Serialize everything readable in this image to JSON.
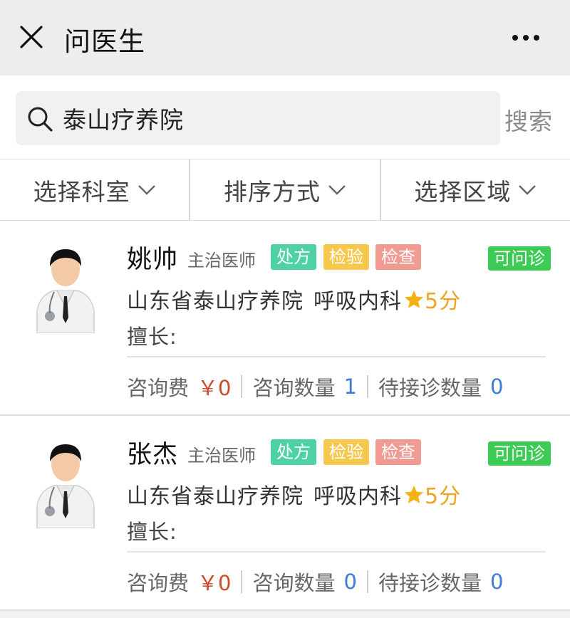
{
  "topbar": {
    "title": "问医生",
    "close_icon": "close-icon",
    "more_icon": "more-icon"
  },
  "search": {
    "value": "泰山疗养院",
    "button_label": "搜索",
    "icon": "search-icon"
  },
  "filters": [
    {
      "label": "选择科室",
      "icon": "chevron-down-icon"
    },
    {
      "label": "排序方式",
      "icon": "chevron-down-icon"
    },
    {
      "label": "选择区域",
      "icon": "chevron-down-icon"
    }
  ],
  "doctors": [
    {
      "name": "姚帅",
      "rank": "主治医师",
      "tags": [
        "处方",
        "检验",
        "检查"
      ],
      "status": "可问诊",
      "hospital": "山东省泰山疗养院",
      "department": "呼吸内科",
      "score": "5分",
      "specialty": "擅长:",
      "fee_label": "咨询费",
      "fee": "￥0",
      "consult_label": "咨询数量",
      "consult_count": "1",
      "pending_label": "待接诊数量",
      "pending_count": "0"
    },
    {
      "name": "张杰",
      "rank": "主治医师",
      "tags": [
        "处方",
        "检验",
        "检查"
      ],
      "status": "可问诊",
      "hospital": "山东省泰山疗养院",
      "department": "呼吸内科",
      "score": "5分",
      "specialty": "擅长:",
      "fee_label": "咨询费",
      "fee": "￥0",
      "consult_label": "咨询数量",
      "consult_count": "0",
      "pending_label": "待接诊数量",
      "pending_count": "0"
    }
  ],
  "colors": {
    "tag_rx": "#4ed1a6",
    "tag_lab": "#f6c94e",
    "tag_exam": "#f19a91",
    "status_available": "#3ccc55",
    "score": "#f0a321",
    "fee": "#d04a2b",
    "count": "#3d7bd6"
  }
}
